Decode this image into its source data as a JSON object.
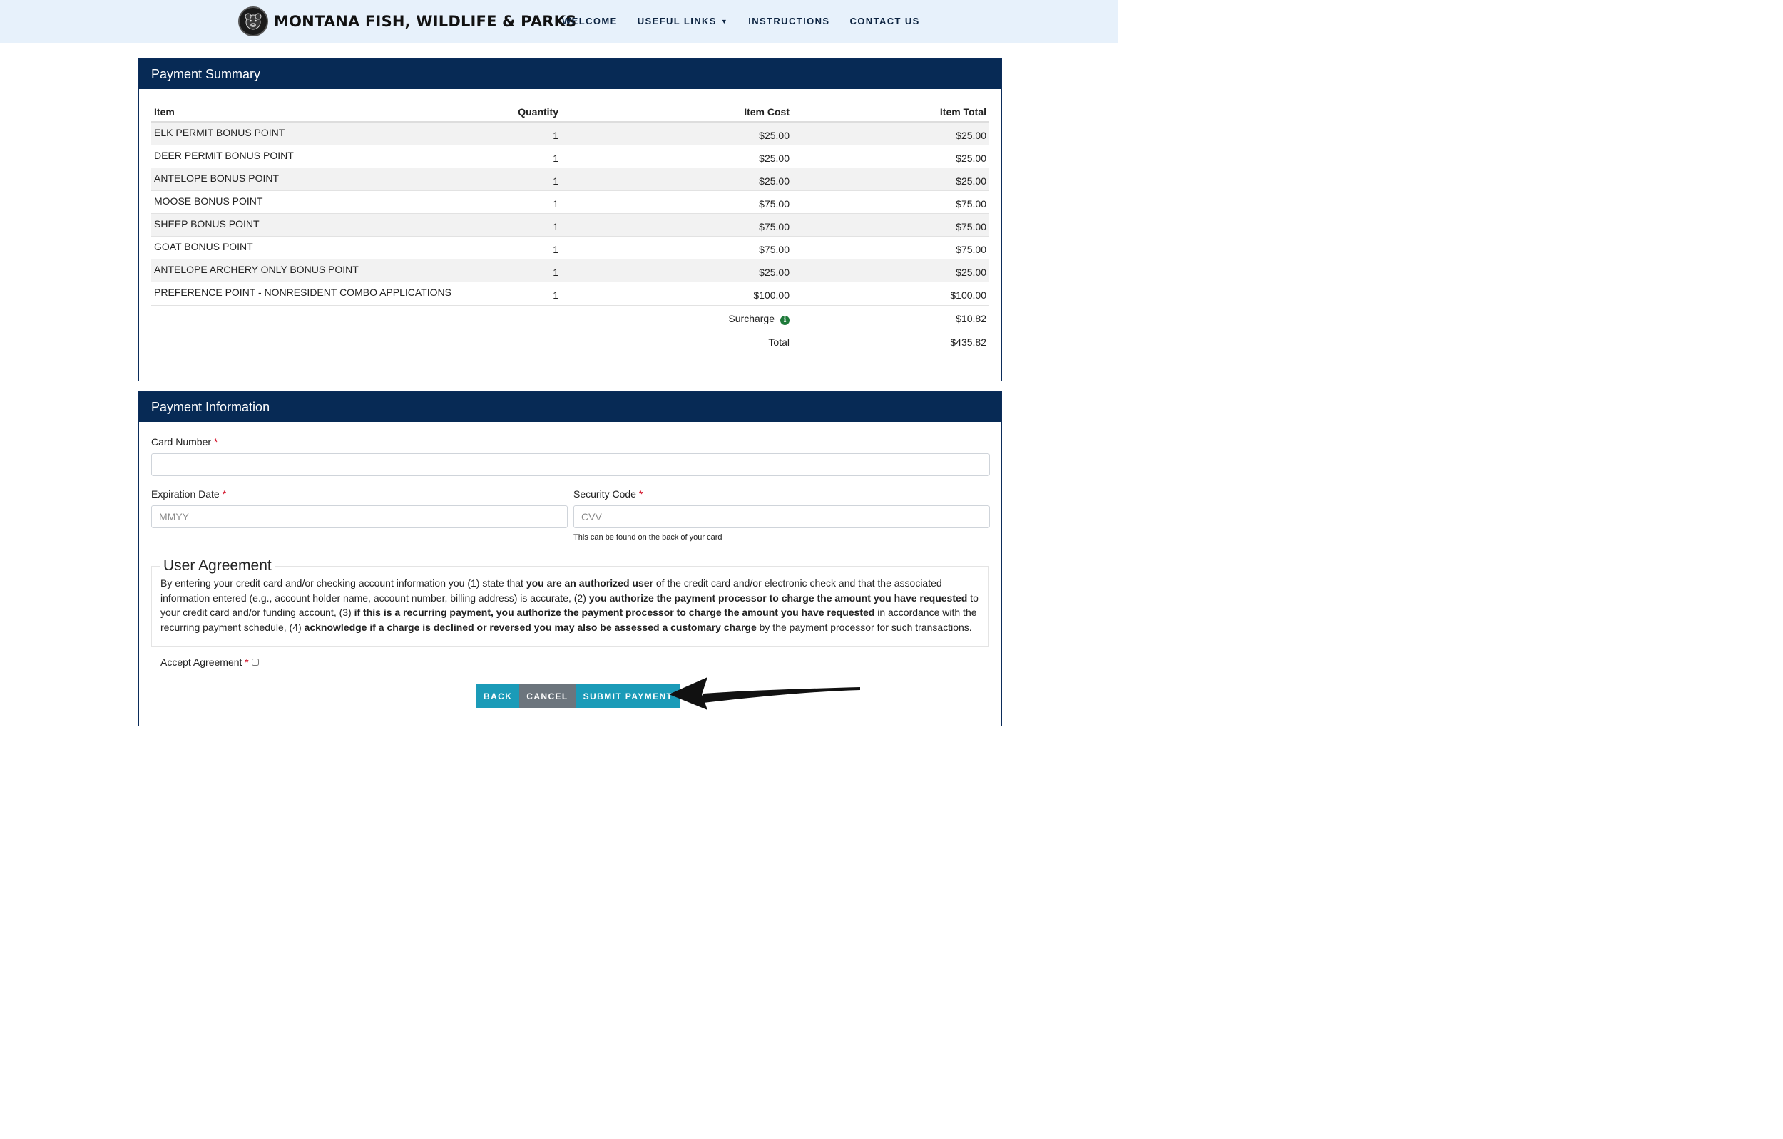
{
  "header": {
    "brand": "MONTANA FISH, WILDLIFE & PARKS",
    "logo_icon": "bear-head-logo",
    "nav": [
      {
        "label": "WELCOME"
      },
      {
        "label": "USEFUL LINKS",
        "dropdown": true
      },
      {
        "label": "INSTRUCTIONS"
      },
      {
        "label": "CONTACT US"
      }
    ]
  },
  "summary": {
    "title": "Payment Summary",
    "columns": {
      "item": "Item",
      "quantity": "Quantity",
      "cost": "Item Cost",
      "total": "Item Total"
    },
    "rows": [
      {
        "item": "ELK PERMIT BONUS POINT",
        "quantity": "1",
        "cost": "$25.00",
        "total": "$25.00"
      },
      {
        "item": "DEER PERMIT BONUS POINT",
        "quantity": "1",
        "cost": "$25.00",
        "total": "$25.00"
      },
      {
        "item": "ANTELOPE BONUS POINT",
        "quantity": "1",
        "cost": "$25.00",
        "total": "$25.00"
      },
      {
        "item": "MOOSE BONUS POINT",
        "quantity": "1",
        "cost": "$75.00",
        "total": "$75.00"
      },
      {
        "item": "SHEEP BONUS POINT",
        "quantity": "1",
        "cost": "$75.00",
        "total": "$75.00"
      },
      {
        "item": "GOAT BONUS POINT",
        "quantity": "1",
        "cost": "$75.00",
        "total": "$75.00"
      },
      {
        "item": "ANTELOPE ARCHERY ONLY BONUS POINT",
        "quantity": "1",
        "cost": "$25.00",
        "total": "$25.00"
      },
      {
        "item": "PREFERENCE POINT - NONRESIDENT COMBO APPLICATIONS",
        "quantity": "1",
        "cost": "$100.00",
        "total": "$100.00"
      }
    ],
    "surcharge_label": "Surcharge",
    "surcharge_icon": "info-icon",
    "surcharge_value": "$10.82",
    "total_label": "Total",
    "total_value": "$435.82"
  },
  "payment": {
    "title": "Payment Information",
    "card_number_label": "Card Number",
    "card_number_value": "",
    "expiration_label": "Expiration Date",
    "expiration_placeholder": "MMYY",
    "security_label": "Security Code",
    "security_placeholder": "CVV",
    "security_help": "This can be found on the back of your card",
    "required_mark": "*"
  },
  "agreement": {
    "legend": "User Agreement",
    "t1": "By entering your credit card and/or checking account information you (1) state that ",
    "b1": "you are an authorized user",
    "t2": " of the credit card and/or electronic check and that the associated information entered (e.g., account holder name, account number, billing address) is accurate, (2) ",
    "b2": "you authorize the payment processor to charge the amount you have requested",
    "t3": " to your credit card and/or funding account, (3) ",
    "b3": "if this is a recurring payment, you authorize the payment processor to charge the amount you have requested",
    "t4": " in accordance with the recurring payment schedule, (4) ",
    "b4": "acknowledge if a charge is declined or reversed you may also be assessed a customary charge",
    "t5": " by the payment processor for such transactions.",
    "accept_label": "Accept Agreement",
    "accepted": false
  },
  "buttons": {
    "back": "BACK",
    "cancel": "CANCEL",
    "submit": "SUBMIT PAYMENT"
  },
  "colors": {
    "panel_header": "#072a55",
    "topbar": "#e7f1fb",
    "button_primary": "#1b9bb8",
    "button_secondary": "#6c757d",
    "required": "#d0021b"
  }
}
